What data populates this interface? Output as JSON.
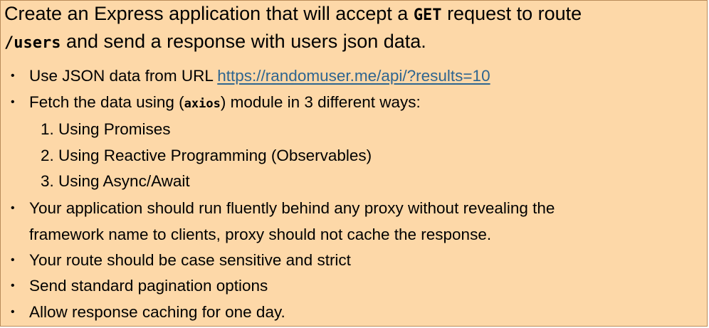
{
  "heading": {
    "part1": "Create an Express application that will accept a ",
    "code1": "GET",
    "part2": " request to route",
    "code2": "/users",
    "part3": " and send a response with users json data."
  },
  "bullets": {
    "b1_text": "Use JSON data from URL ",
    "b1_link": "https://randomuser.me/api/?results=10",
    "b2_text1": "Fetch the data using (",
    "b2_code": "axios",
    "b2_text2": ") module in 3 different ways:",
    "sub": [
      "1. Using Promises",
      "2. Using Reactive Programming (Observables)",
      "3. Using Async/Await"
    ],
    "b3_line1": "Your application should run fluently behind any proxy without revealing the",
    "b3_line2": "framework name to clients, proxy should not cache the response.",
    "b4": "Your route should be case sensitive and strict",
    "b5": "Send standard pagination options",
    "b6": "Allow response caching for one day.",
    "bullet_char": "•"
  }
}
